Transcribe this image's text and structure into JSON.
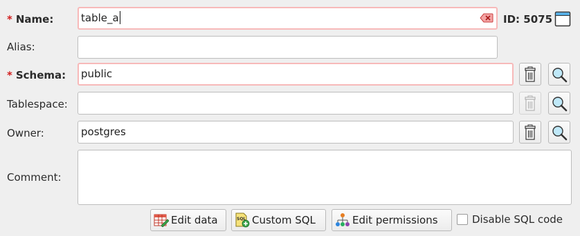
{
  "form": {
    "name": {
      "label": "Name:",
      "required_mark": "*",
      "value": "table_a",
      "clear_icon": "clear-text-icon"
    },
    "id": {
      "label": "ID: 5075",
      "icon": "window-icon"
    },
    "alias": {
      "label": "Alias:",
      "value": ""
    },
    "schema": {
      "label": "Schema:",
      "required_mark": "*",
      "value": "public"
    },
    "tablespace": {
      "label": "Tablespace:",
      "value": ""
    },
    "owner": {
      "label": "Owner:",
      "value": "postgres"
    },
    "comment": {
      "label": "Comment:",
      "value": ""
    }
  },
  "buttons": {
    "edit_data": "Edit data",
    "custom_sql": "Custom SQL",
    "edit_permissions": "Edit permissions"
  },
  "checkbox": {
    "label": "Disable SQL code",
    "checked": false
  },
  "icons": {
    "delete": "trash-icon",
    "search": "magnifier-icon"
  },
  "colors": {
    "required": "#d21f1f",
    "invalid_border": "#f7b9b9",
    "background": "#efefef"
  }
}
